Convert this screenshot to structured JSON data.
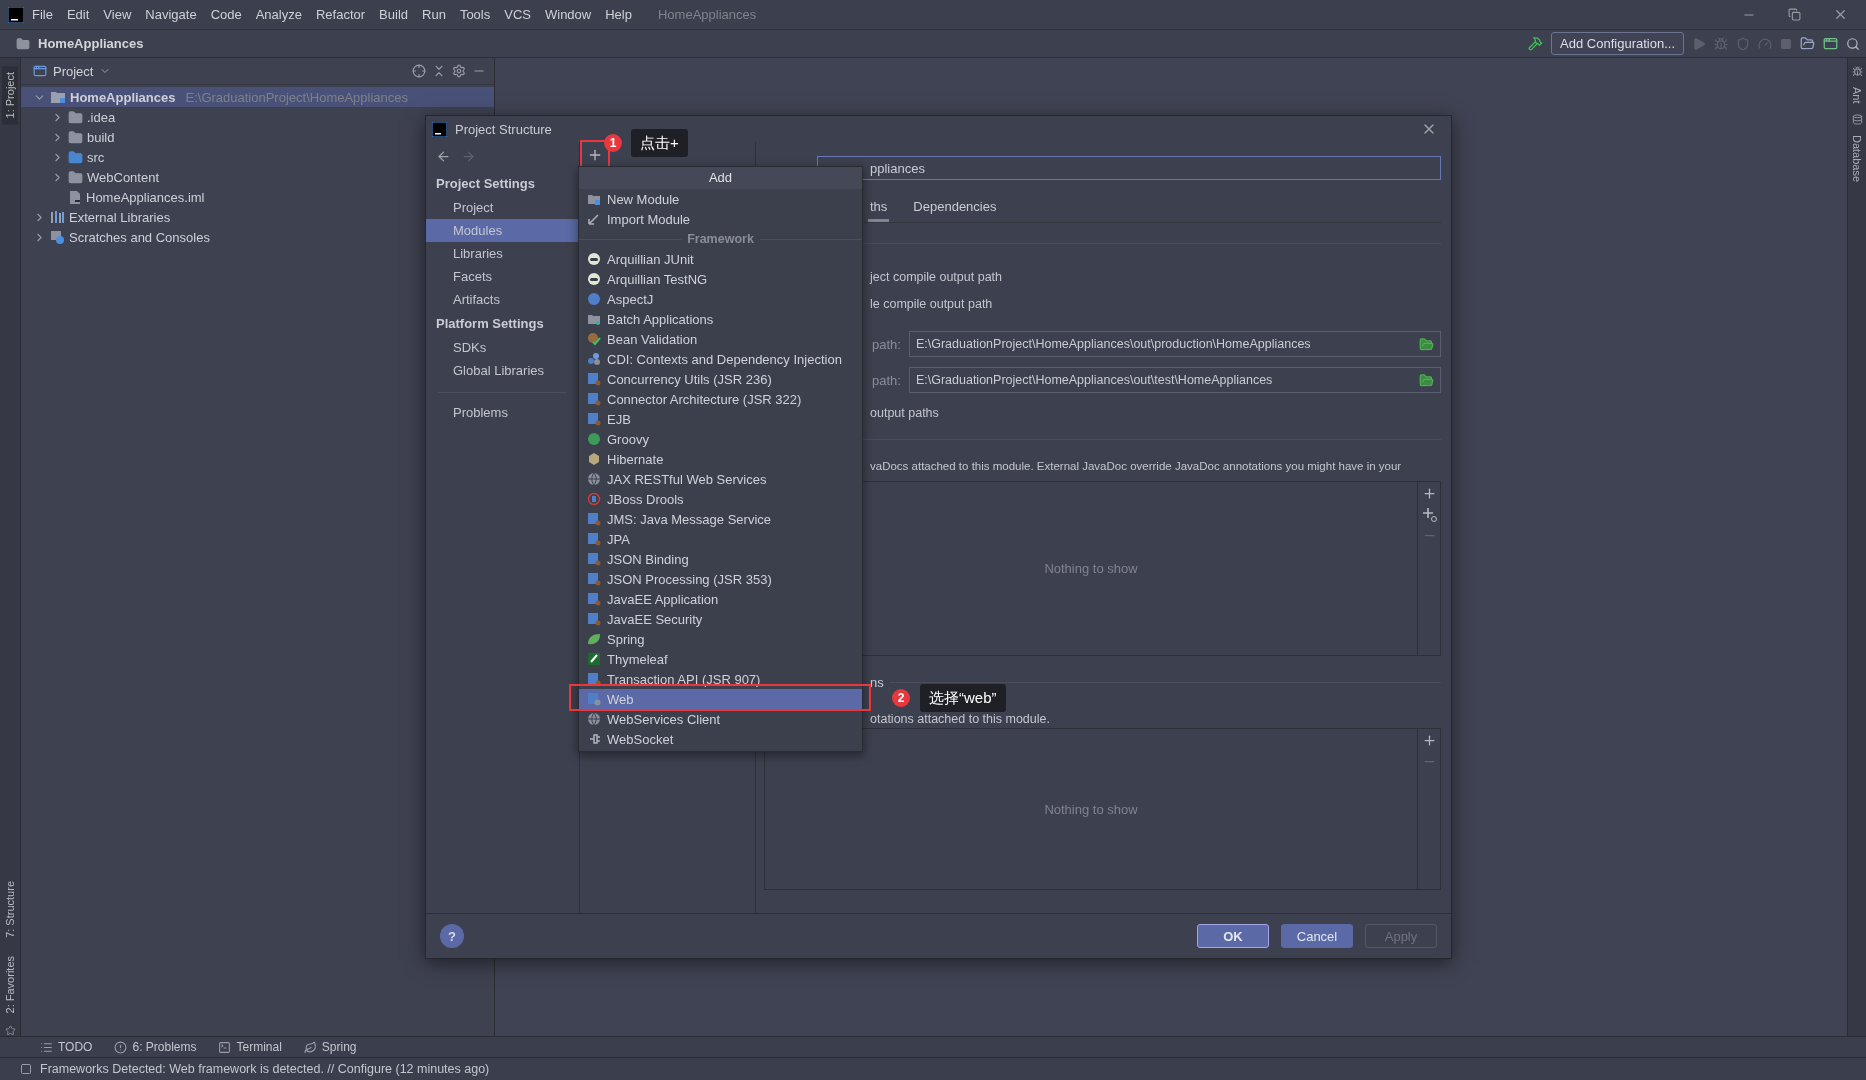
{
  "menu_bar": {
    "items": [
      "File",
      "Edit",
      "View",
      "Navigate",
      "Code",
      "Analyze",
      "Refactor",
      "Build",
      "Run",
      "Tools",
      "VCS",
      "Window",
      "Help"
    ],
    "title": "HomeAppliances"
  },
  "nav_bar": {
    "breadcrumb": "HomeAppliances",
    "run_config": "Add Configuration..."
  },
  "left_stripe": [
    {
      "label": "1: Project",
      "selected": true,
      "kind": "top"
    },
    {
      "label": "7: Structure",
      "selected": false,
      "kind": "bottom"
    },
    {
      "label": "2: Favorites",
      "selected": false,
      "kind": "bottom"
    }
  ],
  "right_stripe": [
    "Ant",
    "Database"
  ],
  "project_panel": {
    "title": "Project",
    "tree": [
      {
        "label": "HomeAppliances",
        "path": "E:\\GraduationProject\\HomeAppliances",
        "kind": "module",
        "expanded": true,
        "selected": true,
        "children": [
          {
            "label": ".idea",
            "kind": "folder",
            "expanded": false,
            "selected": false
          },
          {
            "label": "build",
            "kind": "folder",
            "expanded": false,
            "selected": false
          },
          {
            "label": "src",
            "kind": "source",
            "expanded": false,
            "selected": false
          },
          {
            "label": "WebContent",
            "kind": "folder",
            "expanded": false,
            "selected": false
          },
          {
            "label": "HomeAppliances.iml",
            "kind": "file",
            "selected": false
          }
        ]
      },
      {
        "label": "External Libraries",
        "kind": "libraries",
        "expanded": false,
        "selected": false
      },
      {
        "label": "Scratches and Consoles",
        "kind": "scratches",
        "expanded": false,
        "selected": false
      }
    ]
  },
  "dialog": {
    "title": "Project Structure",
    "sidebar": [
      {
        "title": "Project Settings",
        "items": [
          {
            "label": "Project",
            "selected": false
          },
          {
            "label": "Modules",
            "selected": true
          },
          {
            "label": "Libraries",
            "selected": false
          },
          {
            "label": "Facets",
            "selected": false
          },
          {
            "label": "Artifacts",
            "selected": false
          }
        ]
      },
      {
        "title": "Platform Settings",
        "items": [
          {
            "label": "SDKs",
            "selected": false
          },
          {
            "label": "Global Libraries",
            "selected": false
          }
        ]
      }
    ],
    "sidebar_extra": [
      {
        "label": "Problems",
        "selected": false
      }
    ],
    "name_field": {
      "value": "ppliances"
    },
    "tabs": [
      {
        "label": "ths",
        "selected": true
      },
      {
        "label": "Dependencies",
        "selected": false
      }
    ],
    "options": [
      "ject compile output path",
      "le compile output path"
    ],
    "path_fields": [
      {
        "label": "path:",
        "value": "E:\\GraduationProject\\HomeAppliances\\out\\production\\HomeAppliances"
      },
      {
        "label": "path:",
        "value": "E:\\GraduationProject\\HomeAppliances\\out\\test\\HomeAppliances"
      }
    ],
    "exclude_option": "output paths",
    "javadoc_note": "vaDocs attached to this module. External JavaDoc override JavaDoc annotations you might have in your",
    "javadoc_list": {
      "empty_text": "Nothing to show",
      "tools": [
        {
          "kind": "add",
          "disabled": false
        },
        {
          "kind": "add-link",
          "disabled": false
        },
        {
          "kind": "remove",
          "disabled": true
        }
      ]
    },
    "annotations_heading": "ns",
    "annotations_note": "otations attached to this module.",
    "annotations_list": {
      "empty_text": "Nothing to show",
      "tools": [
        {
          "kind": "add",
          "disabled": false
        },
        {
          "kind": "remove",
          "disabled": true
        }
      ]
    },
    "help_button": "?",
    "buttons": [
      {
        "label": "OK",
        "kind": "default",
        "disabled": false
      },
      {
        "label": "Cancel",
        "kind": "normal",
        "disabled": false
      },
      {
        "label": "Apply",
        "kind": "normal",
        "disabled": true
      }
    ]
  },
  "popup": {
    "title": "Add",
    "items": [
      {
        "label": "New Module",
        "kind": "module",
        "selected": false
      },
      {
        "label": "Import Module",
        "kind": "import",
        "selected": false
      }
    ],
    "section": "Framework",
    "frameworks": [
      {
        "label": "Arquillian JUnit",
        "kind": "arquillian",
        "selected": false
      },
      {
        "label": "Arquillian TestNG",
        "kind": "arquillian",
        "selected": false
      },
      {
        "label": "AspectJ",
        "kind": "aspectj",
        "selected": false
      },
      {
        "label": "Batch Applications",
        "kind": "batch",
        "selected": false
      },
      {
        "label": "Bean Validation",
        "kind": "bean",
        "selected": false
      },
      {
        "label": "CDI: Contexts and Dependency Injection",
        "kind": "cdi",
        "selected": false
      },
      {
        "label": "Concurrency Utils (JSR 236)",
        "kind": "javaee",
        "selected": false
      },
      {
        "label": "Connector Architecture (JSR 322)",
        "kind": "javaee",
        "selected": false
      },
      {
        "label": "EJB",
        "kind": "javaee",
        "selected": false
      },
      {
        "label": "Groovy",
        "kind": "groovy",
        "selected": false
      },
      {
        "label": "Hibernate",
        "kind": "hibernate",
        "selected": false
      },
      {
        "label": "JAX RESTful Web Services",
        "kind": "globe",
        "selected": false
      },
      {
        "label": "JBoss Drools",
        "kind": "drools",
        "selected": false
      },
      {
        "label": "JMS: Java Message Service",
        "kind": "javaee",
        "selected": false
      },
      {
        "label": "JPA",
        "kind": "javaee",
        "selected": false
      },
      {
        "label": "JSON Binding",
        "kind": "javaee",
        "selected": false
      },
      {
        "label": "JSON Processing (JSR 353)",
        "kind": "javaee",
        "selected": false
      },
      {
        "label": "JavaEE Application",
        "kind": "javaee",
        "selected": false
      },
      {
        "label": "JavaEE Security",
        "kind": "javaee",
        "selected": false
      },
      {
        "label": "Spring",
        "kind": "spring",
        "selected": false
      },
      {
        "label": "Thymeleaf",
        "kind": "thymeleaf",
        "selected": false
      },
      {
        "label": "Transaction API (JSR 907)",
        "kind": "javaee",
        "selected": false
      },
      {
        "label": "Web",
        "kind": "web",
        "selected": true
      },
      {
        "label": "WebServices Client",
        "kind": "globe",
        "selected": false
      },
      {
        "label": "WebSocket",
        "kind": "plug",
        "selected": false
      }
    ]
  },
  "callouts": [
    {
      "number": "1",
      "text": "点击+"
    },
    {
      "number": "2",
      "text": "选择“web”"
    }
  ],
  "tool_tabs": [
    {
      "label": "TODO",
      "kind": "todo"
    },
    {
      "label": "6: Problems",
      "kind": "problems"
    },
    {
      "label": "Terminal",
      "kind": "terminal"
    },
    {
      "label": "Spring",
      "kind": "spring"
    }
  ],
  "status_bar": "Frameworks Detected: Web framework is detected. // Configure (12 minutes ago)"
}
